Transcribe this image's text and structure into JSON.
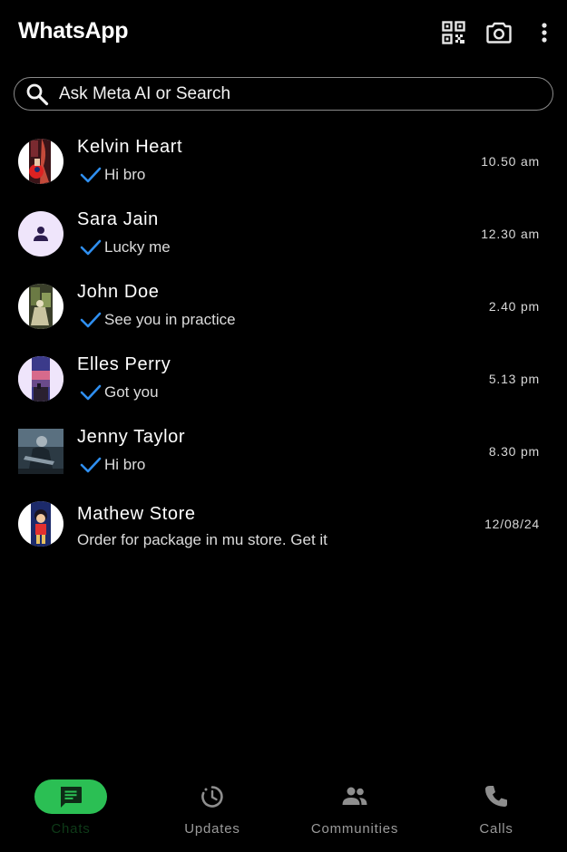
{
  "app": {
    "title": "WhatsApp"
  },
  "toolbar": {
    "icons": [
      "qr-code-icon",
      "camera-icon",
      "more-vert-icon"
    ]
  },
  "search": {
    "placeholder": "Ask Meta AI or Search",
    "icon": "search-icon"
  },
  "colors": {
    "accent": "#2bbf54",
    "check": "#2f8ff0",
    "background": "#000000",
    "avatar_default_bg": "#efe5fb",
    "avatar_default_fg": "#2c1c4e"
  },
  "chats": [
    {
      "name": "Kelvin Heart",
      "message": "Hi bro",
      "time": "10.50 am",
      "read_check": true,
      "avatar": "photo-portrait"
    },
    {
      "name": "Sara Jain",
      "message": "Lucky me",
      "time": "12.30 am",
      "read_check": true,
      "avatar": "default-person-icon"
    },
    {
      "name": "John Doe",
      "message": "See you in practice",
      "time": "2.40 pm",
      "read_check": true,
      "avatar": "photo-forest"
    },
    {
      "name": "Elles Perry",
      "message": "Got you",
      "time": "5.13 pm",
      "read_check": true,
      "avatar": "photo-sunset"
    },
    {
      "name": "Jenny Taylor",
      "message": "Hi bro",
      "time": "8.30 pm",
      "read_check": true,
      "avatar": "photo-guitarist"
    },
    {
      "name": "Mathew Store",
      "message": "Order for package in mu store. Get it",
      "time": "12/08/24",
      "read_check": false,
      "avatar": "photo-cartoon"
    }
  ],
  "bottom_nav": [
    {
      "label": "Chats",
      "icon": "chat-icon",
      "active": true
    },
    {
      "label": "Updates",
      "icon": "updates-icon",
      "active": false
    },
    {
      "label": "Communities",
      "icon": "communities-icon",
      "active": false
    },
    {
      "label": "Calls",
      "icon": "phone-icon",
      "active": false
    }
  ]
}
